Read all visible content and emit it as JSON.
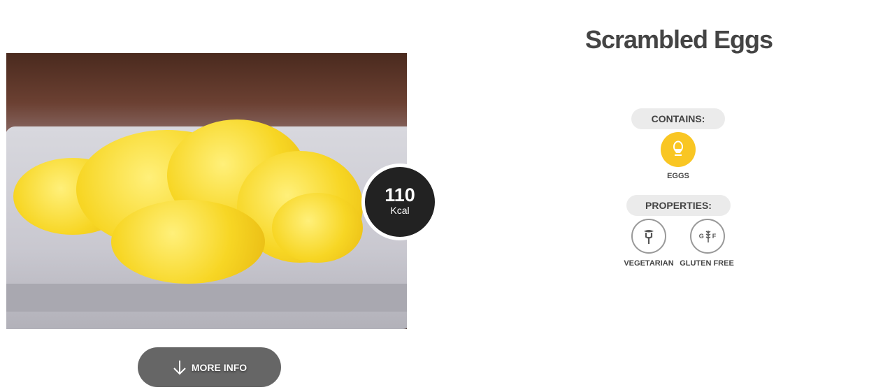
{
  "recipe": {
    "title": "Scrambled Eggs",
    "kcal_value": "110",
    "kcal_unit": "Kcal"
  },
  "more_info_label": "MORE INFO",
  "contains": {
    "heading": "CONTAINS:",
    "items": [
      {
        "label": "EGGS",
        "icon": "egg-icon",
        "color": "#f9c623"
      }
    ]
  },
  "properties": {
    "heading": "PROPERTIES:",
    "items": [
      {
        "label": "VEGETARIAN",
        "icon": "vegetarian-icon"
      },
      {
        "label": "GLUTEN FREE",
        "icon": "gluten-free-icon",
        "icon_text_left": "G",
        "icon_text_right": "F"
      }
    ]
  }
}
